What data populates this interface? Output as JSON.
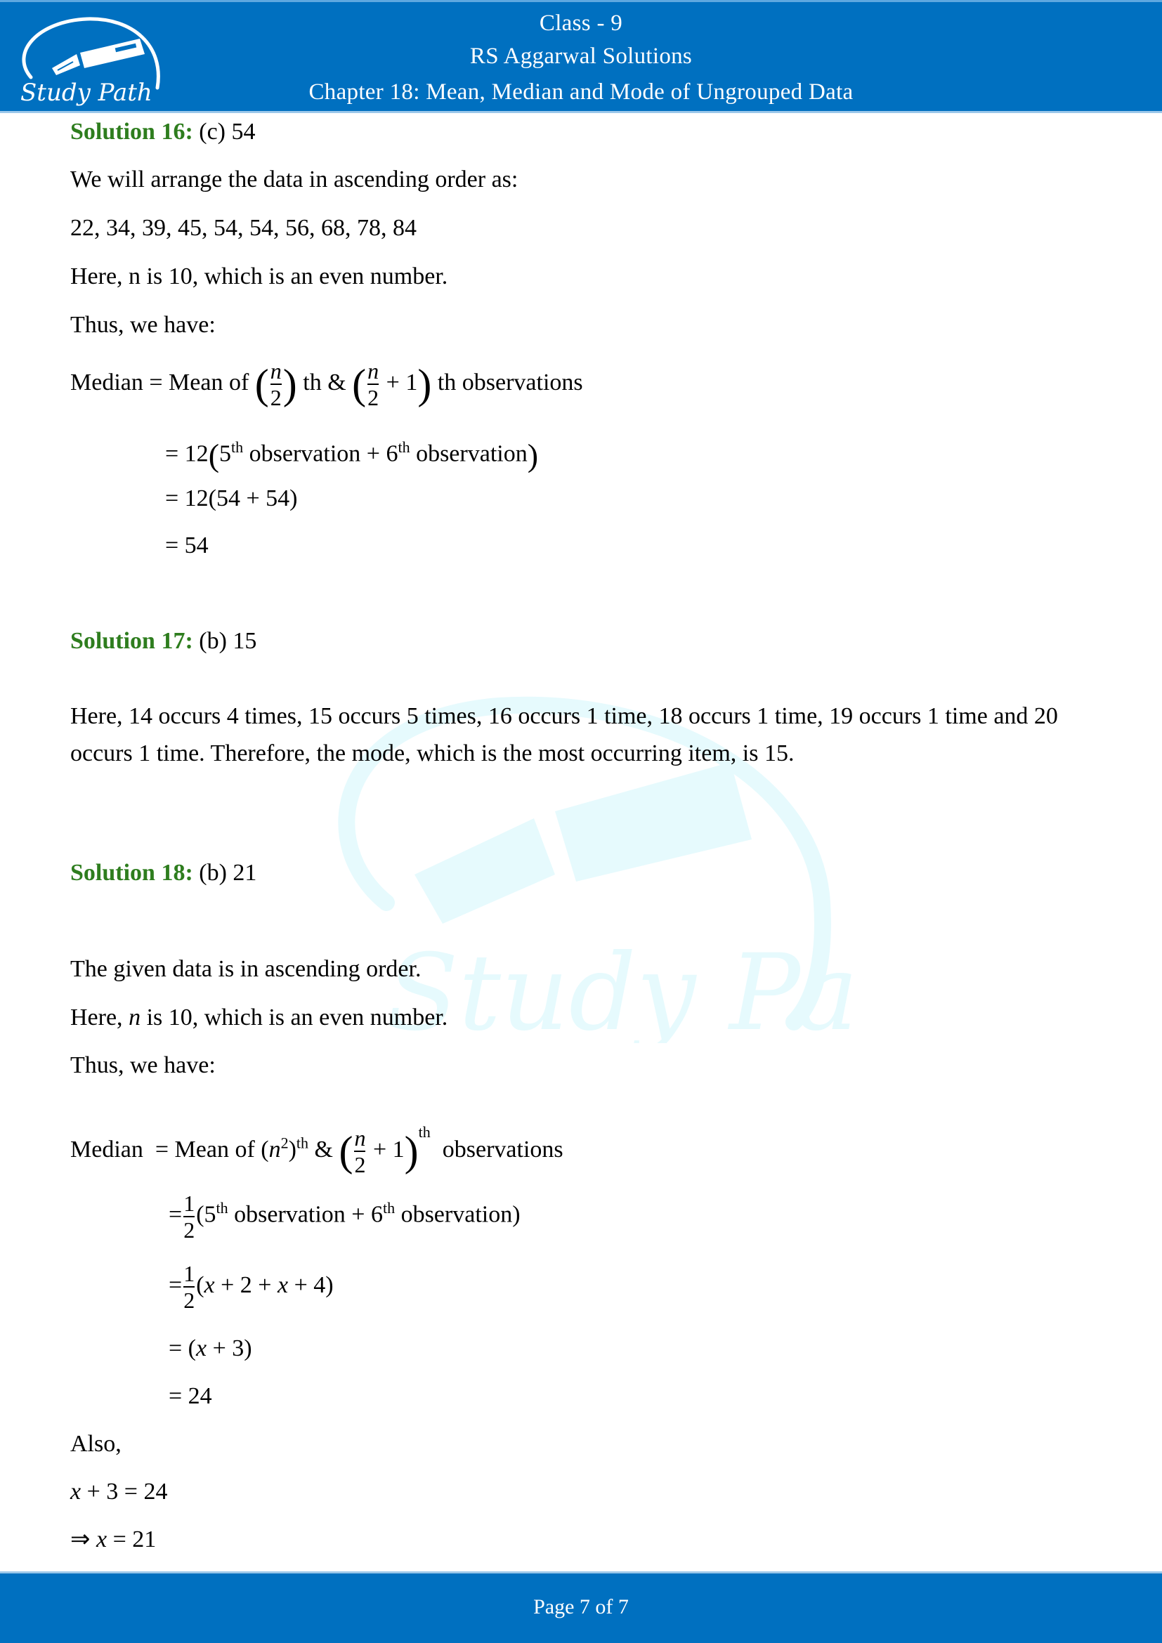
{
  "header": {
    "class": "Class - 9",
    "book": "RS Aggarwal Solutions",
    "chapter": "Chapter 18: Mean, Median and Mode of Ungrouped Data",
    "logo_text": "Study Path",
    "logo_icon": "fountain-pen-icon"
  },
  "watermark": {
    "text": "Study Path",
    "icon": "fountain-pen-icon"
  },
  "colors": {
    "header_bg": "#0070c0",
    "solution_label": "#2e7d1e",
    "watermark": "#e6fafd"
  },
  "solution16": {
    "label": "Solution 16:",
    "answer": "(c) 54",
    "intro": "We will arrange the data in ascending order as:",
    "data": "22, 34, 39, 45, 54, 54, 56, 68, 78, 84",
    "n_line": "Here, n is 10, which is an even number.",
    "thus": "Thus, we have:",
    "median_word": "Median = Mean of",
    "n": "n",
    "two": "2",
    "th": "th",
    "amp": "&",
    "plus_one": "+ 1",
    "observations": "th observations",
    "step1_prefix": "= 12",
    "step1_5": "5",
    "step1_mid": "observation + 6",
    "step1_end": "observation",
    "step2": "= 12(54 + 54)",
    "step3": "= 54"
  },
  "solution17": {
    "label": "Solution 17:",
    "answer": "(b) 15",
    "body": "Here, 14 occurs 4 times, 15 occurs 5 times, 16 occurs 1 time, 18 occurs 1 time, 19 occurs 1 time and 20 occurs 1 time. Therefore, the mode, which is the most occurring item, is 15."
  },
  "solution18": {
    "label": "Solution 18:",
    "answer": "(b) 21",
    "intro": "The given data is in ascending order.",
    "n_line_pre": "Here,",
    "n_var": "n",
    "n_line_post": "is 10, which is an even number.",
    "thus": "Thus, we have:",
    "median_word": "Median",
    "mean_of": "= Mean of (",
    "n": "n",
    "sq": "2",
    "th": "th",
    "amp": "&",
    "two": "2",
    "plus_one": "+ 1",
    "observations": "observations",
    "one": "1",
    "step1_5": "5",
    "step1_mid": "observation + 6",
    "step1_end": "observation)",
    "step2_open": "(",
    "step2_x": "x",
    "step2_mid": "+ 2 +",
    "step2_x2": "x",
    "step2_end": "+ 4)",
    "step3_pre": "= (",
    "step3_x": "x",
    "step3_post": "+ 3)",
    "step4": "= 24",
    "also": "Also,",
    "eq1_x": "x",
    "eq1_rest": "+ 3 = 24",
    "eq2_pre": "⇒",
    "eq2_x": "x",
    "eq2_rest": "= 21"
  },
  "footer": {
    "page_label": "Page 7 of 7"
  }
}
